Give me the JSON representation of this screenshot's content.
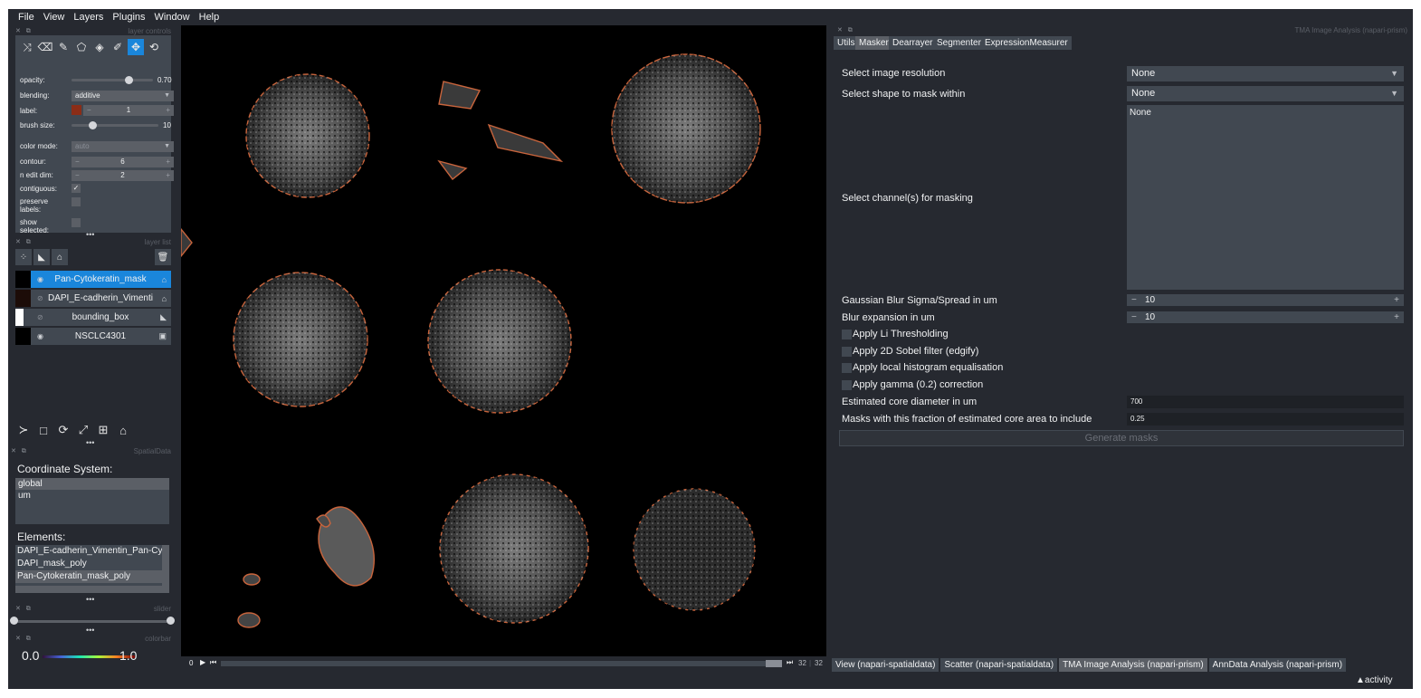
{
  "menu": [
    "File",
    "View",
    "Layers",
    "Plugins",
    "Window",
    "Help"
  ],
  "layer_controls": {
    "header": "layer controls",
    "opacity_label": "opacity:",
    "opacity_value": "0.70",
    "opacity_fraction": 0.7,
    "blending_label": "blending:",
    "blending_value": "additive",
    "label_label": "label:",
    "label_value": "1",
    "label_color": "#8b2d17",
    "brush_label": "brush size:",
    "brush_value": "10",
    "color_mode_label": "color mode:",
    "color_mode_value": "auto",
    "contour_label": "contour:",
    "contour_value": "6",
    "n_edit_dim_label": "n edit dim:",
    "n_edit_dim_value": "2",
    "contiguous_label": "contiguous:",
    "contiguous_checked": true,
    "preserve_label": "preserve labels:",
    "show_selected_label": "show selected:"
  },
  "layer_list": {
    "header": "layer list",
    "layers": [
      {
        "name": "Pan-Cytokeratin_mask",
        "visible": true,
        "type": "labels-icon",
        "selected": true
      },
      {
        "name": "DAPI_E-cadherin_Vimentin...",
        "visible": false,
        "type": "labels-icon",
        "selected": false
      },
      {
        "name": "bounding_box",
        "visible": false,
        "type": "shapes-icon",
        "selected": false
      },
      {
        "name": "NSCLC4301",
        "visible": true,
        "type": "image-icon",
        "selected": false
      }
    ]
  },
  "spatialdata": {
    "header": "SpatialData",
    "coord_label": "Coordinate System:",
    "coords": [
      "global",
      "um"
    ],
    "elements_label": "Elements:",
    "elements": [
      "DAPI_E-cadherin_Vimentin_Pan-Cytoke",
      "DAPI_mask_poly",
      "Pan-Cytokeratin_mask_poly"
    ]
  },
  "slider": {
    "header": "slider"
  },
  "colorbar": {
    "header": "colorbar",
    "min": "0.0",
    "max": "1.0"
  },
  "dims": {
    "start": "0",
    "current": "32",
    "total": "32"
  },
  "right_panel": {
    "header": "TMA Image Analysis (napari-prism)",
    "tabs": [
      "Utils",
      "Masker",
      "Dearrayer",
      "Segmenter",
      "ExpressionMeasurer"
    ],
    "resolution_label": "Select image resolution",
    "resolution_value": "None",
    "shape_label": "Select shape to mask within",
    "shape_value": "None",
    "channels_label": "Select channel(s) for masking",
    "channels_value": "None",
    "sigma_label": "Gaussian Blur Sigma/Spread in um",
    "sigma_value": "10",
    "expansion_label": "Blur expansion in um",
    "expansion_value": "10",
    "checks": [
      "Apply Li Thresholding",
      "Apply 2D Sobel filter (edgify)",
      "Apply local histogram equalisation",
      "Apply gamma (0.2) correction"
    ],
    "diameter_label": "Estimated core diameter in um",
    "diameter_value": "700",
    "fraction_label": "Masks with this fraction of estimated core area to include",
    "fraction_value": "0.25",
    "generate_label": "Generate masks"
  },
  "bottom_tabs": [
    "View (napari-spatialdata)",
    "Scatter (napari-spatialdata)",
    "TMA Image Analysis (napari-prism)",
    "AnnData Analysis (napari-prism)"
  ],
  "activity": "activity"
}
